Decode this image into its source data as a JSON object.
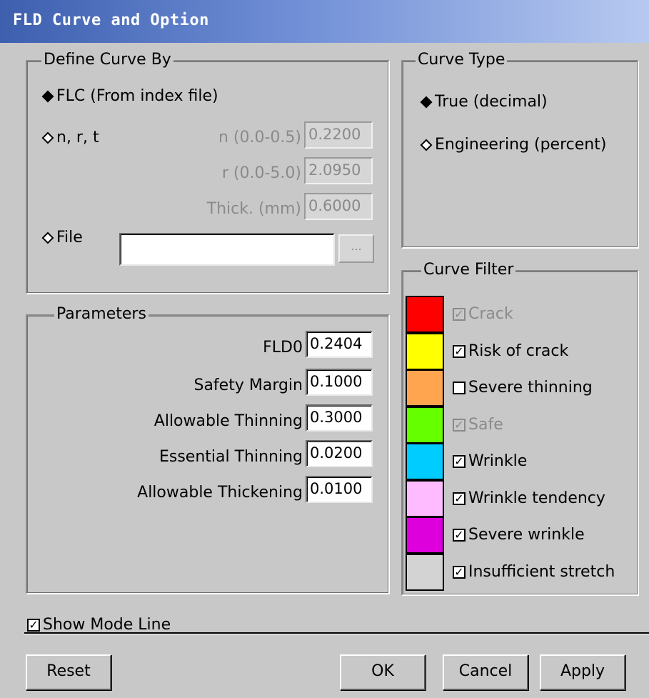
{
  "window": {
    "title": "FLD Curve and Option"
  },
  "define_curve": {
    "legend": "Define Curve By",
    "flc_label": "FLC (From index file)",
    "nrt_label": "n, r, t",
    "n_label": "n (0.0-0.5)",
    "n_value": "0.2200",
    "r_label": "r (0.0-5.0)",
    "r_value": "2.0950",
    "thick_label": "Thick. (mm)",
    "thick_value": "0.6000",
    "file_label": "File",
    "file_value": "",
    "browse_label": "..."
  },
  "curve_type": {
    "legend": "Curve Type",
    "true_label": "True (decimal)",
    "eng_label": "Engineering (percent)"
  },
  "parameters": {
    "legend": "Parameters",
    "fld0_label": "FLD0",
    "fld0_value": "0.2404",
    "safety_label": "Safety Margin",
    "safety_value": "0.1000",
    "allow_thin_label": "Allowable Thinning",
    "allow_thin_value": "0.3000",
    "ess_thin_label": "Essential Thinning",
    "ess_thin_value": "0.0200",
    "allow_thick_label": "Allowable Thickening",
    "allow_thick_value": "0.0100"
  },
  "curve_filter": {
    "legend": "Curve Filter",
    "items": [
      {
        "label": "Crack",
        "color": "#ff0000",
        "checked": true,
        "enabled": false
      },
      {
        "label": "Risk of crack",
        "color": "#ffff00",
        "checked": true,
        "enabled": true
      },
      {
        "label": "Severe thinning",
        "color": "#ffa54f",
        "checked": false,
        "enabled": true
      },
      {
        "label": "Safe",
        "color": "#66ff00",
        "checked": true,
        "enabled": false
      },
      {
        "label": "Wrinkle",
        "color": "#00ccff",
        "checked": true,
        "enabled": true
      },
      {
        "label": "Wrinkle tendency",
        "color": "#ffbbff",
        "checked": true,
        "enabled": true
      },
      {
        "label": "Severe wrinkle",
        "color": "#dd00dd",
        "checked": true,
        "enabled": true
      },
      {
        "label": "Insufficient stretch",
        "color": "#d3d3d3",
        "checked": true,
        "enabled": true
      }
    ]
  },
  "show_mode_line": {
    "label": "Show Mode Line",
    "checked": true
  },
  "buttons": {
    "reset": "Reset",
    "ok": "OK",
    "cancel": "Cancel",
    "apply": "Apply"
  }
}
